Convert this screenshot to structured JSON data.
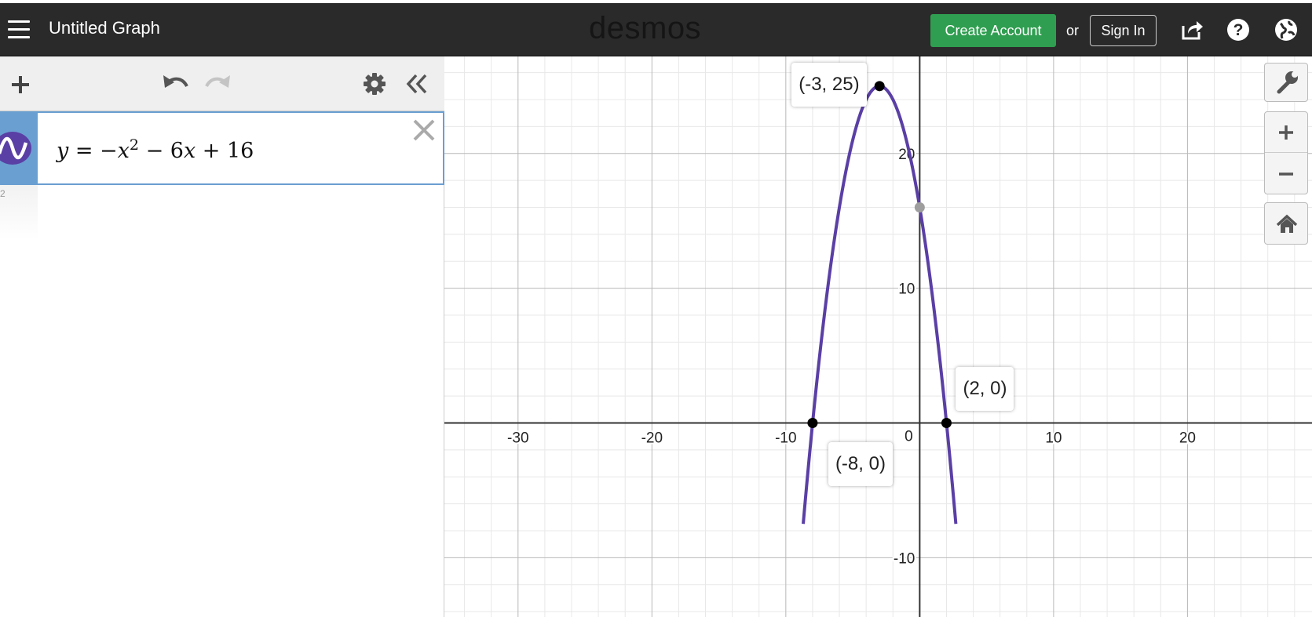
{
  "header": {
    "menu_icon": "hamburger-menu-icon",
    "title": "Untitled Graph",
    "logo": "desmos",
    "create_account": "Create Account",
    "or": "or",
    "sign_in": "Sign In",
    "icons": [
      "share-icon",
      "help-icon",
      "language-globe-icon"
    ]
  },
  "toolbar": {
    "icons": [
      "add-icon",
      "undo-icon",
      "redo-icon",
      "settings-gear-icon",
      "collapse-panel-icon"
    ]
  },
  "expressions": [
    {
      "index": "1",
      "lhs": "y",
      "eq": " = −",
      "term1": "x",
      "exp": "2",
      "rest1": " − 6",
      "term2": "x",
      "rest2": " + 16",
      "color": "#5a3fa5"
    }
  ],
  "empty_expression_index": "2",
  "graph_buttons": [
    "wrench-icon",
    "zoom-in-icon",
    "zoom-out-icon",
    "home-icon"
  ],
  "chart_data": {
    "type": "line",
    "title": "",
    "xlabel": "",
    "ylabel": "",
    "function": "y = -x^2 - 6x + 16",
    "xlim": [
      -35.5,
      29.3
    ],
    "ylim": [
      -14.4,
      27.2
    ],
    "x_ticks": [
      -30,
      -20,
      -10,
      0,
      10,
      20
    ],
    "y_ticks": [
      -10,
      10,
      20
    ],
    "grid": true,
    "series": [
      {
        "color": "#5a3fa5",
        "x": [
          -8.7,
          -8,
          -7,
          -6,
          -5,
          -4,
          -3,
          -2,
          -1,
          0,
          1,
          2,
          2.7
        ],
        "y": [
          -4.9,
          0,
          9,
          16,
          21,
          24,
          25,
          24,
          21,
          16,
          9,
          0,
          -4.9
        ]
      }
    ],
    "points": [
      {
        "x": -3,
        "y": 25,
        "label": "(-3, 25)",
        "color": "#000000"
      },
      {
        "x": -8,
        "y": 0,
        "label": "(-8, 0)",
        "color": "#000000"
      },
      {
        "x": 2,
        "y": 0,
        "label": "(2, 0)",
        "color": "#000000"
      },
      {
        "x": 0,
        "y": 16,
        "label": "",
        "color": "#9e9e9e"
      }
    ]
  }
}
